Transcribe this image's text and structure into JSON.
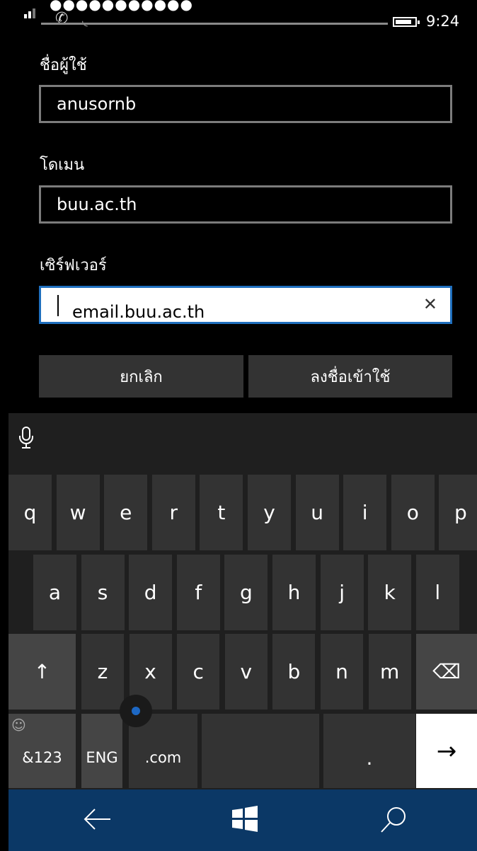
{
  "status_bar": {
    "time": "9:24",
    "battery_level": 0.85,
    "password_dots": "●●●●●●●●●●●"
  },
  "form": {
    "username": {
      "label": "ชื่อผู้ใช้",
      "value": "anusornb"
    },
    "domain": {
      "label": "โดเมน",
      "value": "buu.ac.th"
    },
    "server": {
      "label": "เซิร์ฟเวอร์",
      "value": "email.buu.ac.th"
    },
    "cancel_label": "ยกเลิก",
    "signin_label": "ลงชื่อเข้าใช้"
  },
  "keyboard": {
    "row1": [
      "q",
      "w",
      "e",
      "r",
      "t",
      "y",
      "u",
      "i",
      "o",
      "p"
    ],
    "row2": [
      "a",
      "s",
      "d",
      "f",
      "g",
      "h",
      "j",
      "k",
      "l"
    ],
    "row3": [
      "z",
      "x",
      "c",
      "v",
      "b",
      "n",
      "m"
    ],
    "shift_symbol": "↑",
    "backspace_symbol": "⌫",
    "numbers_label": "&123",
    "language_label": "ENG",
    "dotcom_label": ".com",
    "period_label": ".",
    "enter_symbol": "→",
    "emoji_symbol": "☺"
  },
  "icons": {
    "microphone": "microphone-icon",
    "back": "back-arrow-icon",
    "start": "windows-logo-icon",
    "search": "search-icon"
  },
  "colors": {
    "accent": "#1f6fbe",
    "navbar": "#0b3866",
    "key": "#333333",
    "keyboard_bg": "#1f1f1f"
  }
}
